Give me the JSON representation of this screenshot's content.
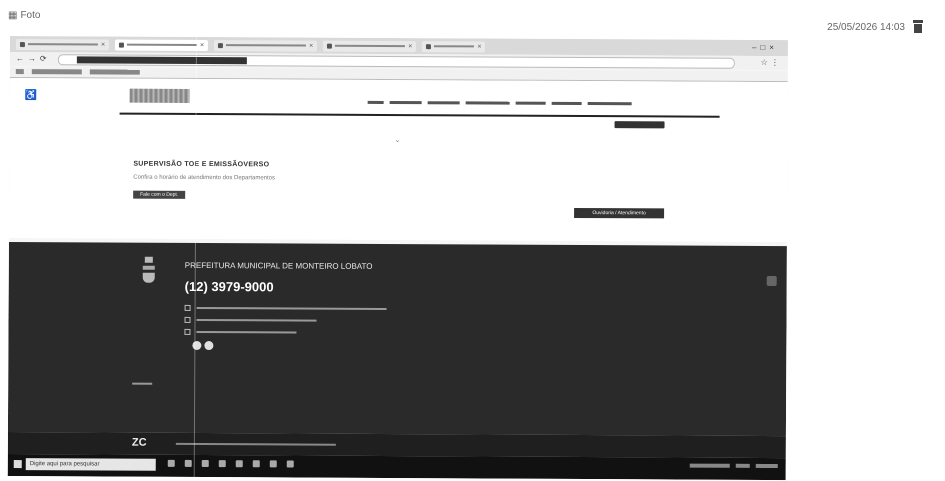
{
  "header": {
    "label": "Foto",
    "timestamp": "25/05/2026 14:03",
    "photo_icon": "photo-icon",
    "delete_icon": "trash-icon"
  },
  "browser": {
    "tabs": [
      "tab",
      "tab",
      "tab",
      "tab",
      "tab"
    ]
  },
  "site": {
    "accessibility_label": "Acessibilidade",
    "department_title": "SUPERVISÃO TOE E EMISSÃOVERSO",
    "department_subtitle": "Confira o horário de atendimento dos Departamentos",
    "section_button": "Fale com o Dept.",
    "right_button": "Ouvidoria / Atendimento"
  },
  "footer": {
    "title": "PREFEITURA MUNICIPAL DE MONTEIRO LOBATO",
    "phone": "(12) 3979-9000",
    "logo_text": "ZC"
  },
  "taskbar": {
    "search_placeholder": "Digite aqui para pesquisar"
  }
}
